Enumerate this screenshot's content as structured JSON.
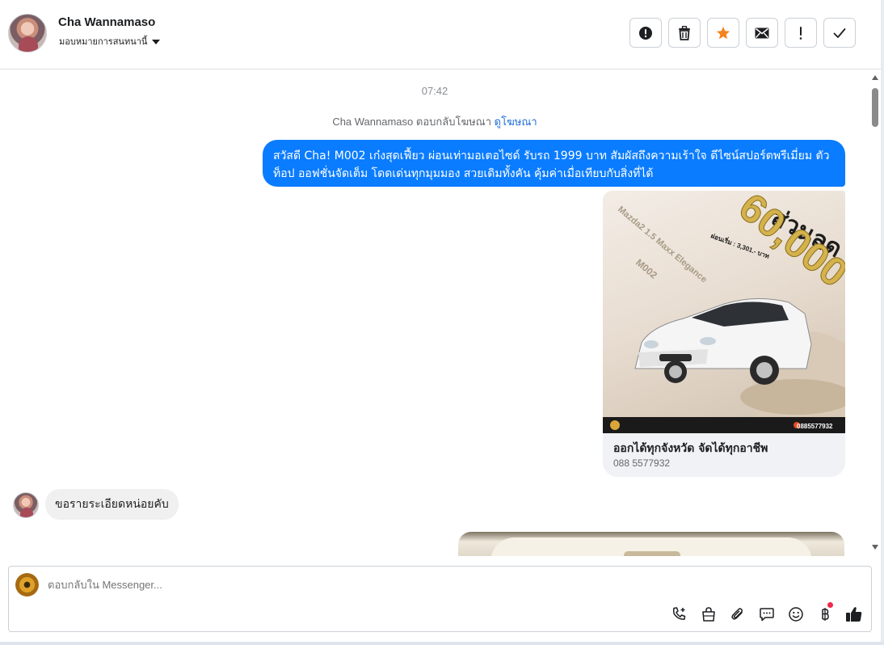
{
  "header": {
    "contact_name": "Cha Wannamaso",
    "assign_label": "มอบหมายการสนทนานี้",
    "actions": [
      {
        "name": "report-spam-button",
        "icon": "alert-circle-icon"
      },
      {
        "name": "delete-button",
        "icon": "trash-icon"
      },
      {
        "name": "star-button",
        "icon": "star-icon",
        "color": "#f5821f"
      },
      {
        "name": "mark-unread-button",
        "icon": "envelope-icon"
      },
      {
        "name": "mark-important-button",
        "icon": "exclamation-icon"
      },
      {
        "name": "mark-done-button",
        "icon": "check-icon"
      }
    ]
  },
  "conversation": {
    "timestamp": "07:42",
    "ad_reply_text": "Cha Wannamaso ตอบกลับโฆษณา",
    "ad_reply_link": "ดูโฆษณา",
    "outgoing_message": "สวัสดี Cha! M002 เก๋งสุดเฟี้ยว ผ่อนเท่ามอเตอไซด์ รับรถ 1999 บาท สัมผัสถึงความเร้าใจ ดีไซน์สปอร์ตพรีเมี่ยม ตัวท็อป ออฟชั่นจัดเต็ม โดดเด่นทุกมุมมอง สวยเดิมทั้งคัน คุ้มค่าเมื่อเทียบกับสิ่งที่ได้",
    "ad_card": {
      "image_discount_label": "ส่วนลด",
      "image_discount_value": "60,000",
      "image_model": "Mazda2 1.5 Maxx Elegance",
      "image_code": "M002",
      "image_installment": "ผ่อนเริ่ม : 3,301.- บาท",
      "image_phone": "0885577932",
      "title": "ออกได้ทุกจังหวัด จัดได้ทุกอาชีพ",
      "subtitle": "088 5577932"
    },
    "incoming_message": "ขอรายระเอียดหน่อยคับ"
  },
  "composer": {
    "placeholder": "ตอบกลับใน Messenger...",
    "tools": [
      "phone-plus-icon",
      "shopping-bag-icon",
      "paperclip-icon",
      "chat-bubble-icon",
      "smiley-icon",
      "baht-icon",
      "thumbs-up-icon"
    ]
  },
  "colors": {
    "outgoing_bubble": "#0a7cff",
    "incoming_bubble": "#f0f0f0",
    "link": "#216fdb",
    "star": "#f5821f",
    "notification_dot": "#f0284a"
  }
}
